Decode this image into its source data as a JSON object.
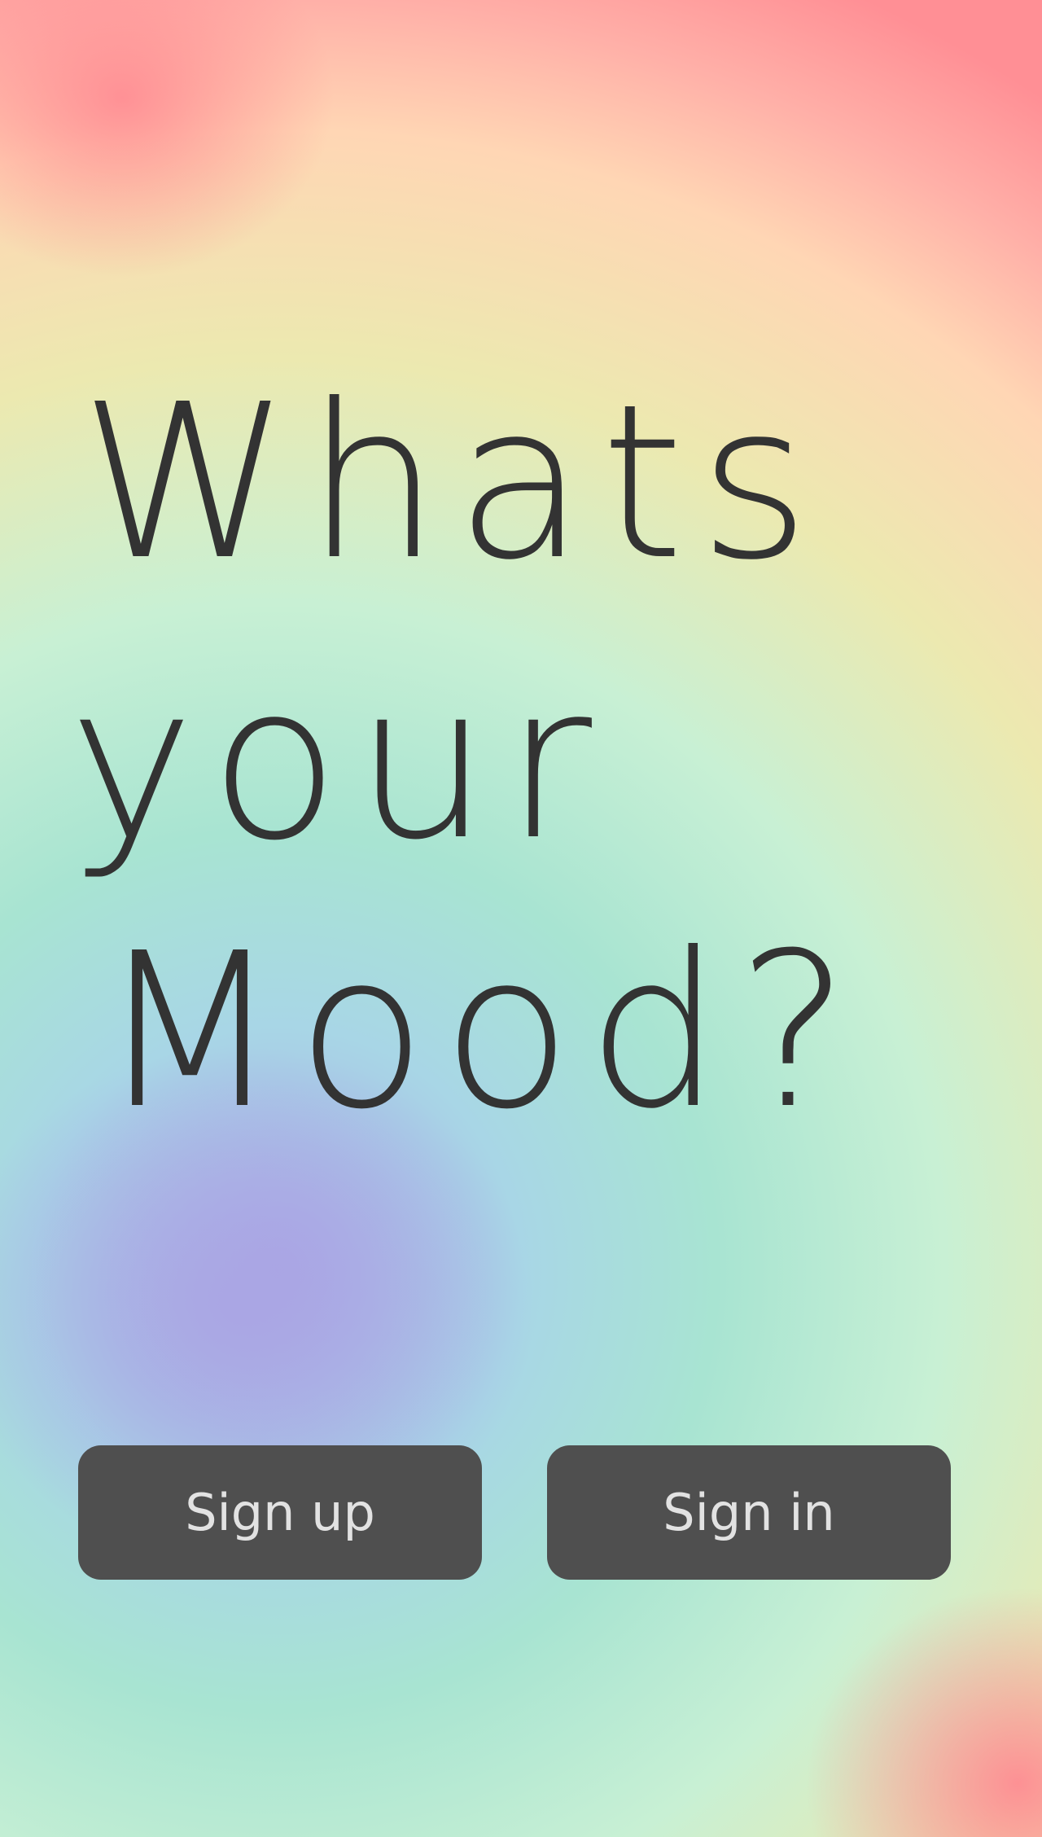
{
  "heading": {
    "line1": "Whats",
    "line2": "your",
    "line3": "Mood?"
  },
  "buttons": {
    "sign_up": "Sign up",
    "sign_in": "Sign in"
  },
  "colors": {
    "text": "#333333",
    "button_bg": "#4f4f4f",
    "button_text": "#e2e2e2"
  }
}
